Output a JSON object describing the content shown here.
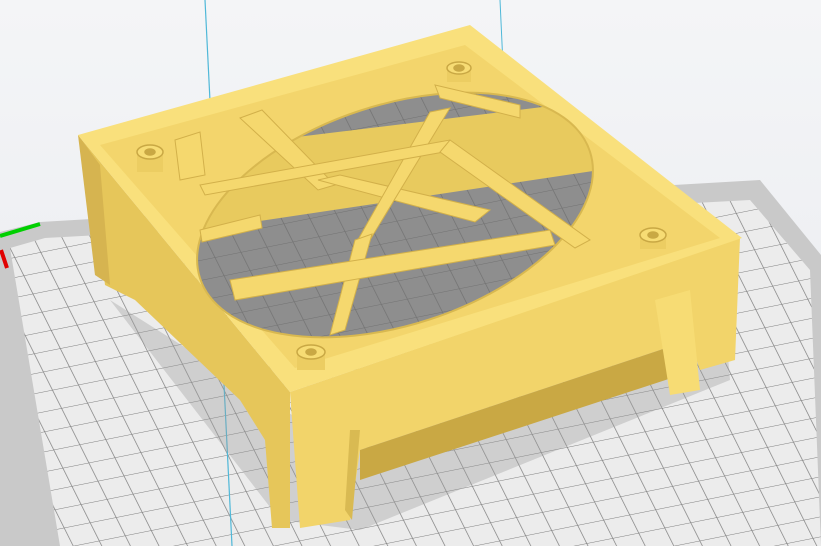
{
  "viewport": {
    "type": "3d-build-plate-view",
    "colors": {
      "background": "#eef0f3",
      "plate": "#e4e4e4",
      "plate_border": "#c4c4c4",
      "grid_line": "#8a8a8a",
      "model": "#f7dc74",
      "model_shade": "#e6c65a",
      "model_dark": "#c9a844",
      "axis_x": "#e00000",
      "axis_y": "#00d000",
      "axis_line": "#4fb8d8"
    }
  }
}
